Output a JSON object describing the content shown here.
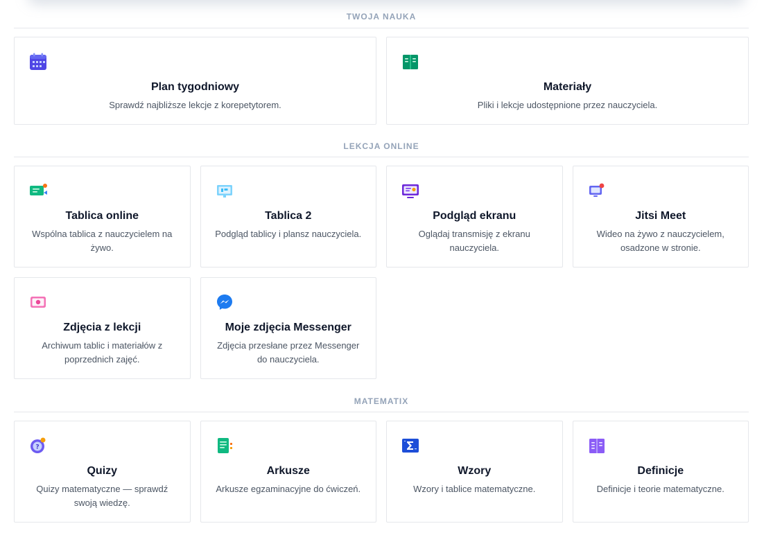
{
  "sections": [
    {
      "title": "TWOJA NAUKA",
      "cards": [
        {
          "title": "Plan tygodniowy",
          "desc": "Sprawdź najbliższe lekcje z korepetytorem."
        },
        {
          "title": "Materiały",
          "desc": "Pliki i lekcje udostępnione przez nauczyciela."
        }
      ]
    },
    {
      "title": "LEKCJA ONLINE",
      "cards": [
        {
          "title": "Tablica online",
          "desc": "Wspólna tablica z nauczycielem na żywo."
        },
        {
          "title": "Tablica 2",
          "desc": "Podgląd tablicy i plansz nauczyciela."
        },
        {
          "title": "Podgląd ekranu",
          "desc": "Oglądaj transmisję z ekranu nauczyciela."
        },
        {
          "title": "Jitsi Meet",
          "desc": "Wideo na żywo z nauczycielem, osadzone w stronie."
        },
        {
          "title": "Zdjęcia z lekcji",
          "desc": "Archiwum tablic i materiałów z poprzednich zajęć."
        },
        {
          "title": "Moje zdjęcia Messenger",
          "desc": "Zdjęcia przesłane przez Messenger do nauczyciela."
        }
      ]
    },
    {
      "title": "MATEMATIX",
      "cards": [
        {
          "title": "Quizy",
          "desc": "Quizy matematyczne — sprawdź swoją wiedzę."
        },
        {
          "title": "Arkusze",
          "desc": "Arkusze egzaminacyjne do ćwiczeń."
        },
        {
          "title": "Wzory",
          "desc": "Wzory i tablice matematyczne."
        },
        {
          "title": "Definicje",
          "desc": "Definicje i teorie matematyczne."
        }
      ]
    }
  ],
  "icons": {
    "calendar": "calendar-icon",
    "materials": "book-icon",
    "whiteboard": "whiteboard-icon",
    "whiteboard2": "monitor-icon",
    "screen": "screen-share-icon",
    "jitsi": "video-call-icon",
    "photos": "photo-icon",
    "messenger": "messenger-icon",
    "quiz": "quiz-icon",
    "sheets": "worksheet-icon",
    "formulas": "sigma-icon",
    "definitions": "definitions-book-icon"
  },
  "colors": {
    "section_title": "#94a3b8",
    "card_border": "#e5e7eb",
    "calendar": "#4f46e5",
    "materials": "#059669",
    "whiteboard": "#10b981",
    "monitor": "#38bdf8",
    "screen": "#6d28d9",
    "jitsi": "#6366f1",
    "photos": "#ec4899",
    "messenger": "#1d7bf0",
    "quiz": "#6d5bf1",
    "sheets": "#10b981",
    "sigma": "#1d4ed8",
    "definitions": "#8b5cf6"
  }
}
